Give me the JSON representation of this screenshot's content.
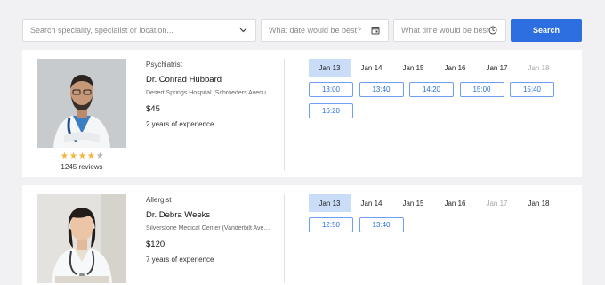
{
  "search": {
    "specialty_placeholder": "Search speciality, specialist or location...",
    "date_placeholder": "What date would be best?",
    "time_placeholder": "What time would be best?",
    "button_label": "Search"
  },
  "doctors": [
    {
      "specialty": "Psychiatrist",
      "name": "Dr. Conrad Hubbard",
      "hospital": "Desert Springs Hospital (Schroeders Avenue ...",
      "price": "$45",
      "experience": "2 years of experience",
      "rating": 4,
      "rating_max": 5,
      "reviews": "1245 reviews",
      "dates": [
        {
          "label": "Jan 13",
          "state": "selected"
        },
        {
          "label": "Jan 14",
          "state": "available"
        },
        {
          "label": "Jan 15",
          "state": "available"
        },
        {
          "label": "Jan 16",
          "state": "available"
        },
        {
          "label": "Jan 17",
          "state": "available"
        },
        {
          "label": "Jan 18",
          "state": "disabled"
        }
      ],
      "times": [
        "13:00",
        "13:40",
        "14:20",
        "15:00",
        "15:40",
        "16:20"
      ]
    },
    {
      "specialty": "Allergist",
      "name": "Dr. Debra Weeks",
      "hospital": "Silverstone Medical Center (Vanderbilt Avenu...",
      "price": "$120",
      "experience": "7 years of experience",
      "dates": [
        {
          "label": "Jan 13",
          "state": "selected"
        },
        {
          "label": "Jan 14",
          "state": "available"
        },
        {
          "label": "Jan 15",
          "state": "available"
        },
        {
          "label": "Jan 16",
          "state": "available"
        },
        {
          "label": "Jan 17",
          "state": "disabled"
        },
        {
          "label": "Jan 18",
          "state": "available"
        }
      ],
      "times": [
        "12:50",
        "13:40"
      ]
    }
  ],
  "colors": {
    "accent": "#2d6fe0",
    "selected_date_bg": "#c9dcf8",
    "star": "#f2b43a"
  }
}
